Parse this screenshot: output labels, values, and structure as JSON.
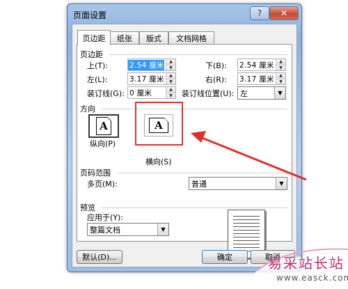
{
  "window": {
    "title": "页面设置",
    "help_glyph": "?",
    "close_glyph": "✕"
  },
  "tabs": [
    {
      "label": "页边距",
      "active": true
    },
    {
      "label": "纸张",
      "active": false
    },
    {
      "label": "版式",
      "active": false
    },
    {
      "label": "文档网格",
      "active": false
    }
  ],
  "margins": {
    "group_title": "页边距",
    "top_label": "上(T):",
    "top_value": "2.54 厘米",
    "bottom_label": "下(B):",
    "bottom_value": "2.54 厘米",
    "left_label": "左(L):",
    "left_value": "3.17 厘米",
    "right_label": "右(R):",
    "right_value": "3.17 厘米",
    "gutter_label": "装订线(G):",
    "gutter_value": "0 厘米",
    "gutter_pos_label": "装订线位置(U):",
    "gutter_pos_value": "左"
  },
  "orientation": {
    "group_title": "方向",
    "portrait_label": "纵向(P)",
    "landscape_label": "横向(S)",
    "icon_letter": "A",
    "selected": "portrait"
  },
  "pages": {
    "group_title": "页码范围",
    "multiple_label": "多页(M):",
    "multiple_value": "普通"
  },
  "preview": {
    "group_title": "预览",
    "apply_label": "应用于(Y):",
    "apply_value": "整篇文档"
  },
  "buttons": {
    "default": "默认(D)...",
    "ok": "确定",
    "cancel": "取消"
  },
  "watermark": {
    "text": "易采站长站",
    "url": "www.easck.com"
  },
  "colors": {
    "annotation_red": "#e0302a",
    "selection_blue": "#3399ff"
  }
}
